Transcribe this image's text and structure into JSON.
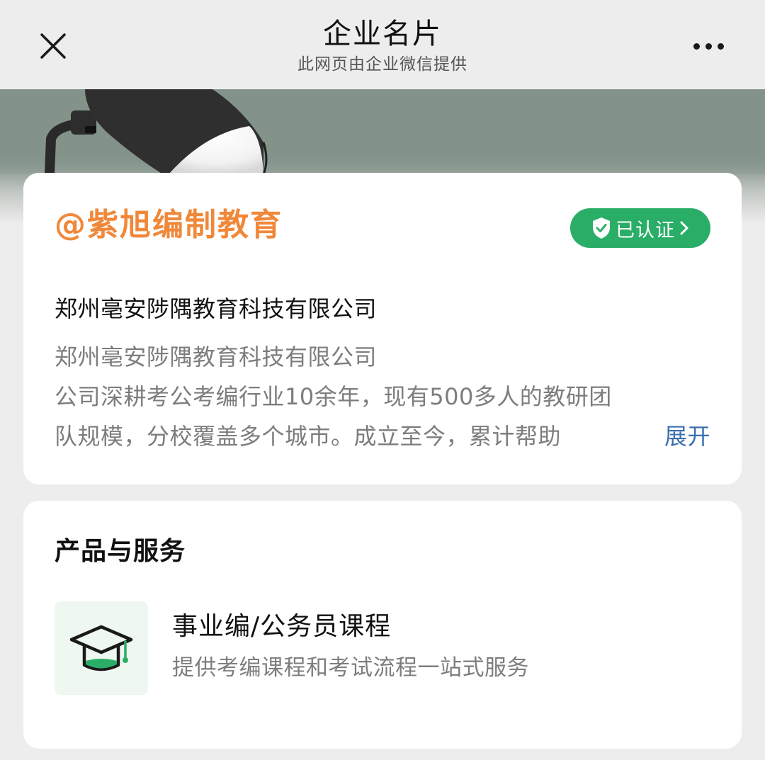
{
  "header": {
    "title": "企业名片",
    "subtitle": "此网页由企业微信提供",
    "close_icon": "close-icon",
    "more_icon": "more-dots-icon"
  },
  "company": {
    "brand_name": "@紫旭编制教育",
    "verified_label": "已认证",
    "verified_icon": "shield-check-icon",
    "company_name": "郑州亳安陟隅教育科技有限公司",
    "description_lines": [
      "郑州亳安陟隅教育科技有限公司",
      "公司深耕考公考编行业10余年，现有500多人的教研团",
      "队规模，分校覆盖多个城市。成立至今，累计帮助"
    ],
    "expand_label": "展开"
  },
  "products": {
    "section_title": "产品与服务",
    "items": [
      {
        "icon": "graduation-cap-icon",
        "title": "事业编/公务员课程",
        "description": "提供考编课程和考试流程一站式服务"
      }
    ]
  },
  "colors": {
    "brand_orange": "#f0883a",
    "verified_green": "#2aae67",
    "link_blue": "#3a6fb0",
    "icon_green": "#2aae67"
  }
}
